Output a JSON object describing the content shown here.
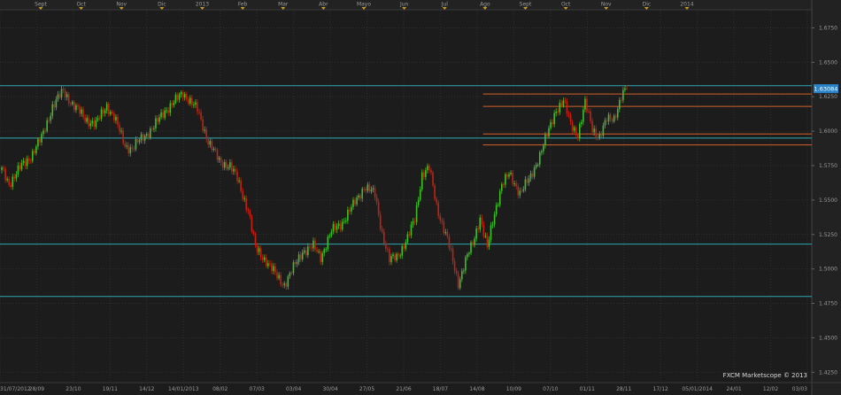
{
  "chart_data": {
    "type": "candlestick",
    "colors": {
      "background": "#1c1c1c",
      "up": "#3fbf2a",
      "down": "#c8200e",
      "grid": "#2e2e2e",
      "support_line": "#2fa6b0",
      "channel_line": "#d2602a",
      "price_label_bg": "#2a83c8",
      "month_marker": "#c69a27"
    },
    "ylim": [
      1.4175,
      1.6875
    ],
    "y_ticks": [
      "1.6750",
      "1.6500",
      "1.6250",
      "1.6000",
      "1.5750",
      "1.5500",
      "1.5250",
      "1.5000",
      "1.4750",
      "1.4500",
      "1.4250"
    ],
    "x_labels": [
      "31/07/2012",
      "28/09",
      "23/10",
      "19/11",
      "14/12",
      "14/01/2013",
      "08/02",
      "07/03",
      "03/04",
      "30/04",
      "27/05",
      "21/06",
      "18/07",
      "14/08",
      "10/09",
      "07/10",
      "01/11",
      "28/11",
      "17/12",
      "05/01/2014",
      "24/01",
      "12/02",
      "03/03"
    ],
    "month_markers": [
      "Sept",
      "Oct",
      "Nov",
      "Dic",
      "2013",
      "Feb",
      "Mar",
      "Abr",
      "Mayo",
      "Jun",
      "Jul",
      "Ago",
      "Sept",
      "Oct",
      "Nov",
      "Dic",
      "2014"
    ],
    "current_price": "1.63084",
    "watermark": "FXCM Marketscope © 2013",
    "anchors": [
      [
        0,
        1.572
      ],
      [
        4,
        1.562
      ],
      [
        10,
        1.573
      ],
      [
        16,
        1.582
      ],
      [
        22,
        1.595
      ],
      [
        28,
        1.618
      ],
      [
        34,
        1.629
      ],
      [
        40,
        1.618
      ],
      [
        46,
        1.609
      ],
      [
        52,
        1.605
      ],
      [
        58,
        1.619
      ],
      [
        62,
        1.61
      ],
      [
        68,
        1.59
      ],
      [
        72,
        1.587
      ],
      [
        78,
        1.596
      ],
      [
        84,
        1.603
      ],
      [
        90,
        1.615
      ],
      [
        96,
        1.622
      ],
      [
        100,
        1.628
      ],
      [
        104,
        1.622
      ],
      [
        108,
        1.615
      ],
      [
        114,
        1.593
      ],
      [
        120,
        1.578
      ],
      [
        126,
        1.575
      ],
      [
        130,
        1.565
      ],
      [
        136,
        1.543
      ],
      [
        140,
        1.515
      ],
      [
        146,
        1.506
      ],
      [
        152,
        1.494
      ],
      [
        156,
        1.489
      ],
      [
        160,
        1.498
      ],
      [
        166,
        1.513
      ],
      [
        172,
        1.516
      ],
      [
        176,
        1.509
      ],
      [
        182,
        1.527
      ],
      [
        188,
        1.534
      ],
      [
        194,
        1.546
      ],
      [
        200,
        1.56
      ],
      [
        206,
        1.554
      ],
      [
        210,
        1.526
      ],
      [
        214,
        1.506
      ],
      [
        218,
        1.509
      ],
      [
        224,
        1.522
      ],
      [
        228,
        1.536
      ],
      [
        232,
        1.569
      ],
      [
        236,
        1.573
      ],
      [
        240,
        1.546
      ],
      [
        246,
        1.521
      ],
      [
        250,
        1.5
      ],
      [
        252,
        1.49
      ],
      [
        256,
        1.506
      ],
      [
        260,
        1.518
      ],
      [
        264,
        1.538
      ],
      [
        268,
        1.515
      ],
      [
        272,
        1.54
      ],
      [
        276,
        1.562
      ],
      [
        280,
        1.568
      ],
      [
        286,
        1.556
      ],
      [
        292,
        1.566
      ],
      [
        298,
        1.587
      ],
      [
        302,
        1.6
      ],
      [
        306,
        1.616
      ],
      [
        310,
        1.622
      ],
      [
        314,
        1.605
      ],
      [
        318,
        1.598
      ],
      [
        322,
        1.62
      ],
      [
        326,
        1.602
      ],
      [
        330,
        1.596
      ],
      [
        334,
        1.608
      ],
      [
        338,
        1.61
      ],
      [
        342,
        1.625
      ],
      [
        345,
        1.6308
      ]
    ],
    "horizontal_lines": [
      {
        "kind": "support",
        "y": 1.633,
        "x0": 0.0,
        "x1": 1.0
      },
      {
        "kind": "support",
        "y": 1.595,
        "x0": 0.0,
        "x1": 1.0
      },
      {
        "kind": "support",
        "y": 1.518,
        "x0": 0.0,
        "x1": 1.0
      },
      {
        "kind": "support",
        "y": 1.48,
        "x0": 0.0,
        "x1": 1.0
      },
      {
        "kind": "channel",
        "y": 1.627,
        "x0": 0.595,
        "x1": 1.0
      },
      {
        "kind": "channel",
        "y": 1.618,
        "x0": 0.595,
        "x1": 1.0
      },
      {
        "kind": "channel",
        "y": 1.598,
        "x0": 0.595,
        "x1": 1.0
      },
      {
        "kind": "channel",
        "y": 1.59,
        "x0": 0.595,
        "x1": 1.0
      }
    ]
  }
}
